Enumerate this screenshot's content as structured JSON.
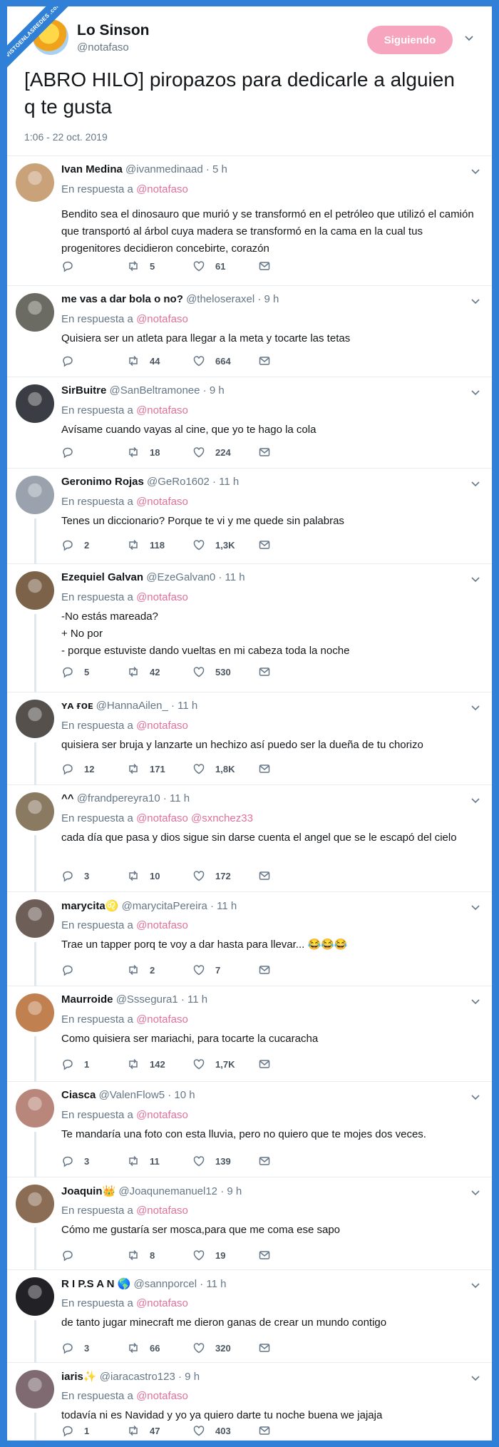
{
  "watermark": "VISTOENLASREDES .com",
  "author": {
    "name": "Lo Sinson",
    "handle": "@notafaso",
    "follow_label": "Siguiendo"
  },
  "main_tweet": {
    "text": "[ABRO HILO] piropazos para dedicarle a alguien q te gusta",
    "time": "1:06 - 22 oct. 2019"
  },
  "reply_prefix": "En respuesta a",
  "replies": [
    {
      "name": "Ivan Medina",
      "handle": "@ivanmedinaad",
      "time": "· 5 h",
      "mention": "@notafaso",
      "text": "Bendito sea el dinosauro que murió y se transformó en el petróleo que utilizó el camión que transportó al árbol cuya madera se transformó en la cama en la cual tus progenitores decidieron concebirte, corazón",
      "replies": "",
      "retweets": "5",
      "likes": "61",
      "avatar_color": "#c9a27a"
    },
    {
      "name": "me vas a dar bola o no?",
      "handle": "@theloseraxel",
      "time": "· 9 h",
      "mention": "@notafaso",
      "text": "Quisiera ser un atleta para llegar a la meta y tocarte las tetas",
      "replies": "",
      "retweets": "44",
      "likes": "664",
      "avatar_color": "#6b6a63"
    },
    {
      "name": "SirBuitre",
      "handle": "@SanBeltramonee",
      "time": "· 9 h",
      "mention": "@notafaso",
      "text": "Avísame cuando vayas al cine, que yo te hago la cola",
      "replies": "",
      "retweets": "18",
      "likes": "224",
      "avatar_color": "#3a3d44"
    },
    {
      "name": "Geronimo Rojas",
      "handle": "@GeRo1602",
      "time": "· 11 h",
      "mention": "@notafaso",
      "text": "Tenes un diccionario? Porque te vi y me quede sin palabras",
      "replies": "2",
      "retweets": "118",
      "likes": "1,3K",
      "avatar_color": "#9aa3ad"
    },
    {
      "name": "Ezequiel Galvan",
      "handle": "@EzeGalvan0",
      "time": "· 11 h",
      "mention": "@notafaso",
      "text": "-No estás mareada?\n+ No por\n- porque estuviste dando vueltas en mi cabeza toda la noche",
      "replies": "5",
      "retweets": "42",
      "likes": "530",
      "avatar_color": "#7c6248"
    },
    {
      "name": "ʏᴀ ғᴏᴇ",
      "handle": "@HannaAilen_",
      "time": "· 11 h",
      "mention": "@notafaso",
      "text": "quisiera ser bruja y lanzarte un hechizo así puedo ser la dueña de tu chorizo",
      "replies": "12",
      "retweets": "171",
      "likes": "1,8K",
      "avatar_color": "#55504c"
    },
    {
      "name": "^^",
      "handle": "@frandpereyra10",
      "time": "· 11 h",
      "mention": "@notafaso @sxnchez33",
      "text": "cada día que pasa y dios sigue sin darse cuenta el angel que se le escapó del cielo",
      "replies": "3",
      "retweets": "10",
      "likes": "172",
      "avatar_color": "#8a7a62"
    },
    {
      "name": "marycita♌",
      "handle": "@marycitaPereira",
      "time": "· 11 h",
      "mention": "@notafaso",
      "text": "Trae un tapper porq te voy a dar hasta para llevar... 😂😂😂",
      "replies": "",
      "retweets": "2",
      "likes": "7",
      "avatar_color": "#6e5e58"
    },
    {
      "name": "Maurroide",
      "handle": "@Sssegura1",
      "time": "· 11 h",
      "mention": "@notafaso",
      "text": "Como quisiera ser mariachi, para tocarte la cucaracha",
      "replies": "1",
      "retweets": "142",
      "likes": "1,7K",
      "avatar_color": "#c08050"
    },
    {
      "name": "Ciasca",
      "handle": "@ValenFlow5",
      "time": "· 10 h",
      "mention": "@notafaso",
      "text": "Te mandaría una foto con esta lluvia, pero no quiero que te mojes dos veces.",
      "replies": "3",
      "retweets": "11",
      "likes": "139",
      "avatar_color": "#b8867a"
    },
    {
      "name": "Joaquin👑",
      "handle": "@Joaqunemanuel12",
      "time": "· 9 h",
      "mention": "@notafaso",
      "text": "Cómo me gustaría ser mosca,para que me coma ese sapo",
      "replies": "",
      "retweets": "8",
      "likes": "19",
      "avatar_color": "#8b6d55"
    },
    {
      "name": "R I P.S A N 🌎",
      "handle": "@sannporcel",
      "time": "· 11 h",
      "mention": "@notafaso",
      "text": "de tanto jugar minecraft me dieron ganas de crear un mundo contigo",
      "replies": "3",
      "retweets": "66",
      "likes": "320",
      "avatar_color": "#222226"
    },
    {
      "name": "iaris✨",
      "handle": "@iaracastro123",
      "time": "· 9 h",
      "mention": "@notafaso",
      "text": "todavía ni es Navidad y yo ya quiero darte tu noche buena we jajaja",
      "replies": "1",
      "retweets": "47",
      "likes": "403",
      "avatar_color": "#7e6a70"
    }
  ],
  "colors": {
    "mention": "#e0719b",
    "follow": "#f7a5bf",
    "thread_line": "#e1e8ed",
    "frame": "#2f80d6"
  },
  "icons": [
    "reply-icon",
    "retweet-icon",
    "like-icon",
    "message-icon",
    "chevron-down-icon"
  ]
}
